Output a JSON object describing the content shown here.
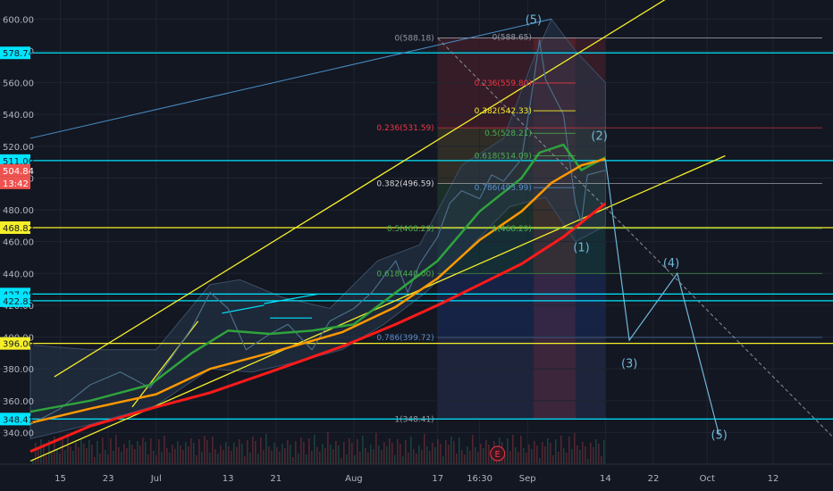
{
  "chart_data": {
    "type": "line",
    "title": "",
    "xlabel": "",
    "ylabel": "",
    "ylim": [
      320,
      612
    ],
    "x_range": [
      "2020-06-10",
      "2020-10-22"
    ],
    "grid": true,
    "colors": {
      "background": "#131722",
      "price": "#4b6e88",
      "bb_band": "#26364a",
      "ma_fast": "#2fa33d",
      "ma_mid": "#ff9800",
      "ma_slow": "#ff1a1a",
      "cyan": "#00e5ff",
      "yellow": "#f5ef2a",
      "wave": "#6fb7d8"
    },
    "y_ticks": [
      "600.00",
      "580.00",
      "560.00",
      "540.00",
      "520.00",
      "500.00",
      "480.00",
      "460.00",
      "440.00",
      "420.00",
      "400.00",
      "380.00",
      "360.00",
      "340.00"
    ],
    "x_ticks": [
      {
        "label": "15",
        "date": "2020-06-15"
      },
      {
        "label": "23",
        "date": "2020-06-23"
      },
      {
        "label": "Jul",
        "date": "2020-07-01"
      },
      {
        "label": "13",
        "date": "2020-07-13"
      },
      {
        "label": "21",
        "date": "2020-07-21"
      },
      {
        "label": "Aug",
        "date": "2020-08-03"
      },
      {
        "label": "17",
        "date": "2020-08-17"
      },
      {
        "label": "16:30",
        "date": "2020-08-24"
      },
      {
        "label": "Sep",
        "date": "2020-09-01"
      },
      {
        "label": "14",
        "date": "2020-09-14"
      },
      {
        "label": "22",
        "date": "2020-09-22"
      },
      {
        "label": "Oct",
        "date": "2020-10-01"
      },
      {
        "label": "12",
        "date": "2020-10-12"
      }
    ],
    "price_tags": [
      {
        "label": "578.74",
        "value": 578.74,
        "color": "cyan"
      },
      {
        "label": "511.00",
        "value": 511.0,
        "color": "cyan"
      },
      {
        "label": "468.82",
        "value": 468.82,
        "color": "yellow"
      },
      {
        "label": "427.05",
        "value": 427.05,
        "color": "cyan"
      },
      {
        "label": "422.83",
        "value": 422.83,
        "color": "cyan"
      },
      {
        "label": "396.00",
        "value": 396.0,
        "color": "yellow"
      },
      {
        "label": "348.41",
        "value": 348.41,
        "color": "cyan"
      }
    ],
    "last_price": {
      "label": "504.84",
      "countdown": "13:42",
      "value": 504.84
    },
    "series": [
      {
        "name": "",
        "key": "price",
        "points": [
          [
            "2020-06-10",
            345
          ],
          [
            "2020-06-15",
            355
          ],
          [
            "2020-06-20",
            370
          ],
          [
            "2020-06-25",
            378
          ],
          [
            "2020-06-30",
            368
          ],
          [
            "2020-07-03",
            384
          ],
          [
            "2020-07-07",
            406
          ],
          [
            "2020-07-10",
            428
          ],
          [
            "2020-07-13",
            418
          ],
          [
            "2020-07-16",
            392
          ],
          [
            "2020-07-20",
            402
          ],
          [
            "2020-07-23",
            408
          ],
          [
            "2020-07-27",
            392
          ],
          [
            "2020-07-30",
            410
          ],
          [
            "2020-08-03",
            418
          ],
          [
            "2020-08-06",
            428
          ],
          [
            "2020-08-10",
            448
          ],
          [
            "2020-08-12",
            428
          ],
          [
            "2020-08-14",
            446
          ],
          [
            "2020-08-17",
            463
          ],
          [
            "2020-08-19",
            484
          ],
          [
            "2020-08-21",
            492
          ],
          [
            "2020-08-24",
            487
          ],
          [
            "2020-08-26",
            502
          ],
          [
            "2020-08-28",
            498
          ],
          [
            "2020-08-31",
            512
          ],
          [
            "2020-09-02",
            560
          ],
          [
            "2020-09-03",
            587
          ],
          [
            "2020-09-04",
            562
          ],
          [
            "2020-09-07",
            540
          ],
          [
            "2020-09-08",
            512
          ],
          [
            "2020-09-09",
            484
          ],
          [
            "2020-09-10",
            472
          ],
          [
            "2020-09-11",
            502
          ],
          [
            "2020-09-14",
            504.84
          ]
        ]
      },
      {
        "name": "",
        "key": "ma_fast",
        "points": [
          [
            "2020-06-10",
            353
          ],
          [
            "2020-06-20",
            360
          ],
          [
            "2020-06-30",
            370
          ],
          [
            "2020-07-07",
            390
          ],
          [
            "2020-07-13",
            404
          ],
          [
            "2020-07-20",
            402
          ],
          [
            "2020-07-27",
            404
          ],
          [
            "2020-08-03",
            408
          ],
          [
            "2020-08-10",
            428
          ],
          [
            "2020-08-17",
            448
          ],
          [
            "2020-08-24",
            479
          ],
          [
            "2020-08-31",
            500
          ],
          [
            "2020-09-03",
            516
          ],
          [
            "2020-09-07",
            521
          ],
          [
            "2020-09-10",
            505
          ],
          [
            "2020-09-14",
            513
          ]
        ]
      },
      {
        "name": "",
        "key": "ma_mid",
        "points": [
          [
            "2020-06-10",
            346
          ],
          [
            "2020-06-20",
            355
          ],
          [
            "2020-07-01",
            364
          ],
          [
            "2020-07-10",
            380
          ],
          [
            "2020-07-20",
            390
          ],
          [
            "2020-08-01",
            403
          ],
          [
            "2020-08-10",
            419
          ],
          [
            "2020-08-17",
            437
          ],
          [
            "2020-08-24",
            461
          ],
          [
            "2020-08-31",
            479
          ],
          [
            "2020-09-05",
            497
          ],
          [
            "2020-09-10",
            508
          ],
          [
            "2020-09-14",
            512
          ]
        ]
      },
      {
        "name": "",
        "key": "ma_slow",
        "points": [
          [
            "2020-06-10",
            328
          ],
          [
            "2020-06-20",
            344
          ],
          [
            "2020-07-01",
            356
          ],
          [
            "2020-07-10",
            365
          ],
          [
            "2020-07-20",
            378
          ],
          [
            "2020-08-01",
            394
          ],
          [
            "2020-08-10",
            408
          ],
          [
            "2020-08-17",
            420
          ],
          [
            "2020-08-24",
            433
          ],
          [
            "2020-08-31",
            446
          ],
          [
            "2020-09-07",
            463
          ],
          [
            "2020-09-14",
            484
          ]
        ]
      }
    ],
    "bollinger": {
      "upper": [
        [
          "2020-06-10",
          395
        ],
        [
          "2020-06-20",
          392
        ],
        [
          "2020-07-01",
          392
        ],
        [
          "2020-07-10",
          433
        ],
        [
          "2020-07-15",
          436
        ],
        [
          "2020-07-22",
          425
        ],
        [
          "2020-07-30",
          418
        ],
        [
          "2020-08-07",
          448
        ],
        [
          "2020-08-14",
          458
        ],
        [
          "2020-08-21",
          508
        ],
        [
          "2020-08-28",
          525
        ],
        [
          "2020-09-02",
          575
        ],
        [
          "2020-09-05",
          600
        ],
        [
          "2020-09-09",
          580
        ],
        [
          "2020-09-14",
          560
        ]
      ],
      "lower": [
        [
          "2020-06-10",
          336
        ],
        [
          "2020-06-20",
          345
        ],
        [
          "2020-07-01",
          357
        ],
        [
          "2020-07-10",
          380
        ],
        [
          "2020-07-17",
          378
        ],
        [
          "2020-07-24",
          384
        ],
        [
          "2020-08-01",
          392
        ],
        [
          "2020-08-08",
          408
        ],
        [
          "2020-08-15",
          428
        ],
        [
          "2020-08-22",
          455
        ],
        [
          "2020-08-29",
          482
        ],
        [
          "2020-09-04",
          488
        ],
        [
          "2020-09-09",
          460
        ],
        [
          "2020-09-14",
          470
        ]
      ]
    },
    "fib_left": {
      "anchor_top": {
        "label": "0(588.18)",
        "value": 588.18
      },
      "anchor_bottom": {
        "label": "1(348.41)",
        "value": 348.41
      },
      "x_range": [
        "2020-08-17",
        "2020-09-14"
      ],
      "levels": [
        {
          "label": "0.236(531.59)",
          "value": 531.59,
          "color": "#f23645"
        },
        {
          "label": "0.382(496.59)",
          "value": 496.59,
          "color": "#d6d7d9"
        },
        {
          "label": "0.5(468.29)",
          "value": 468.29,
          "color": "#4caf50"
        },
        {
          "label": "0.618(440.00)",
          "value": 440.0,
          "color": "#4caf50"
        },
        {
          "label": "0.786(399.72)",
          "value": 399.72,
          "color": "#5a8fd0"
        }
      ]
    },
    "fib_right": {
      "anchor_top": {
        "label": "0(588.65)",
        "value": 588.65
      },
      "x_range": [
        "2020-09-02",
        "2020-09-09"
      ],
      "levels": [
        {
          "label": "0.236(559.80)",
          "value": 559.8,
          "color": "#f23645"
        },
        {
          "label": "0.382(542.33)",
          "value": 542.33,
          "color": "#f5ef2a"
        },
        {
          "label": "0.5(528.21)",
          "value": 528.21,
          "color": "#4caf50"
        },
        {
          "label": "0.618(514.09)",
          "value": 514.09,
          "color": "#4caf50"
        },
        {
          "label": "0.786(493.99)",
          "value": 493.99,
          "color": "#5a8fd0"
        },
        {
          "label": "1(468.29)",
          "value": 468.29,
          "color": "#4caf50"
        }
      ]
    },
    "bands": [
      {
        "from": 531.59,
        "to": 588.18,
        "color": "#f23645"
      },
      {
        "from": 496.59,
        "to": 531.59,
        "color": "#c8a23a"
      },
      {
        "from": 468.29,
        "to": 496.59,
        "color": "#4caf50"
      },
      {
        "from": 440.0,
        "to": 468.29,
        "color": "#26a69a"
      },
      {
        "from": 399.72,
        "to": 440.0,
        "color": "#2962ff"
      },
      {
        "from": 348.41,
        "to": 399.72,
        "color": "#5c6bc0"
      }
    ],
    "wave_labels": [
      {
        "label": "(5)",
        "date": "2020-09-02",
        "value": 597
      },
      {
        "label": "(2)",
        "date": "2020-09-13",
        "value": 524
      },
      {
        "label": "(1)",
        "date": "2020-09-10",
        "value": 454
      },
      {
        "label": "(4)",
        "date": "2020-09-25",
        "value": 444
      },
      {
        "label": "(3)",
        "date": "2020-09-18",
        "value": 381
      },
      {
        "label": "(5)",
        "date": "2020-10-03",
        "value": 336
      }
    ],
    "projection": [
      [
        "2020-09-14",
        512
      ],
      [
        "2020-09-18",
        398
      ],
      [
        "2020-09-26",
        440
      ],
      [
        "2020-10-03",
        338
      ]
    ],
    "trendlines": [
      {
        "color": "yellow",
        "from": [
          "2020-06-10",
          322
        ],
        "to": [
          "2020-10-04",
          514
        ]
      },
      {
        "color": "yellow",
        "from": [
          "2020-06-14",
          375
        ],
        "to": [
          "2020-09-26",
          617
        ]
      },
      {
        "color": "yellow",
        "from": [
          "2020-06-27",
          356
        ],
        "to": [
          "2020-07-08",
          410
        ]
      },
      {
        "color": "blue",
        "from": [
          "2020-06-10",
          525
        ],
        "to": [
          "2020-09-05",
          600
        ]
      },
      {
        "color": "dash",
        "from": [
          "2020-08-17",
          588
        ],
        "to": [
          "2020-10-22",
          337
        ]
      },
      {
        "color": "cyan_short",
        "from": [
          "2020-07-12",
          415
        ],
        "to": [
          "2020-07-19",
          420
        ]
      },
      {
        "color": "cyan_short",
        "from": [
          "2020-07-19",
          421
        ],
        "to": [
          "2020-07-28",
          427
        ]
      },
      {
        "color": "cyan_short",
        "from": [
          "2020-07-20",
          412
        ],
        "to": [
          "2020-07-27",
          412
        ]
      }
    ],
    "earnings_marker": {
      "label": "E",
      "date": "2020-08-27"
    }
  }
}
